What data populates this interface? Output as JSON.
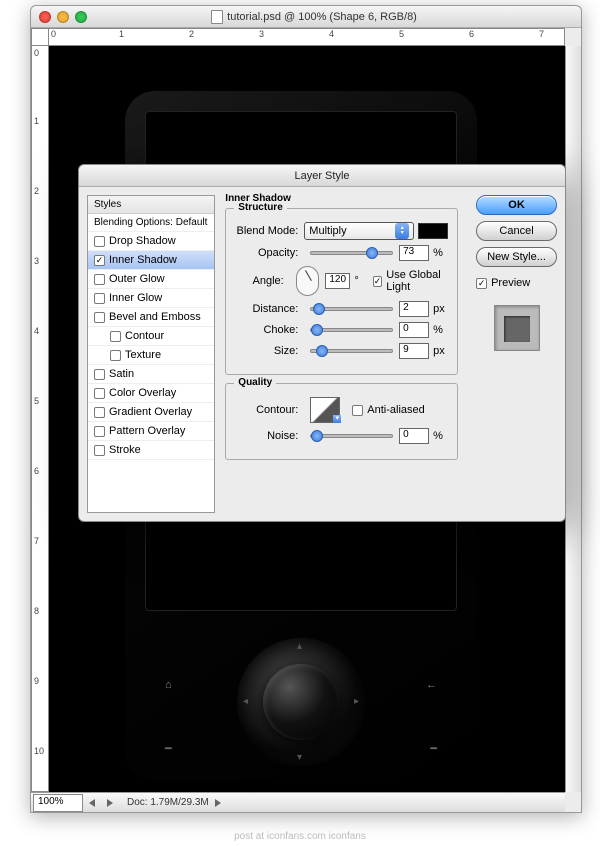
{
  "window": {
    "title": "tutorial.psd @ 100% (Shape 6, RGB/8)",
    "zoom": "100%",
    "doc_size": "Doc: 1.79M/29.3M"
  },
  "ruler_top": [
    "0",
    "1",
    "2",
    "3",
    "4",
    "5",
    "6",
    "7"
  ],
  "ruler_left": [
    "0",
    "1",
    "2",
    "3",
    "4",
    "5",
    "6",
    "7",
    "8",
    "9",
    "10"
  ],
  "dialog": {
    "title": "Layer Style",
    "styles_header": "Styles",
    "blending_header": "Blending Options: Default",
    "items": {
      "drop_shadow": "Drop Shadow",
      "inner_shadow": "Inner Shadow",
      "outer_glow": "Outer Glow",
      "inner_glow": "Inner Glow",
      "bevel": "Bevel and Emboss",
      "contour": "Contour",
      "texture": "Texture",
      "satin": "Satin",
      "color_overlay": "Color Overlay",
      "grad_overlay": "Gradient Overlay",
      "pat_overlay": "Pattern Overlay",
      "stroke": "Stroke"
    },
    "section_title": "Inner Shadow",
    "structure_label": "Structure",
    "quality_label": "Quality",
    "blend_mode_label": "Blend Mode:",
    "blend_mode_value": "Multiply",
    "opacity_label": "Opacity:",
    "opacity_value": "73",
    "angle_label": "Angle:",
    "angle_value": "120",
    "global_light": "Use Global Light",
    "distance_label": "Distance:",
    "distance_value": "2",
    "choke_label": "Choke:",
    "choke_value": "0",
    "size_label": "Size:",
    "size_value": "9",
    "px": "px",
    "pct": "%",
    "deg": "°",
    "contour_label": "Contour:",
    "anti_aliased": "Anti-aliased",
    "noise_label": "Noise:",
    "noise_value": "0",
    "ok": "OK",
    "cancel": "Cancel",
    "new_style": "New Style...",
    "preview": "Preview"
  },
  "footer": "post at iconfans.com iconfans"
}
